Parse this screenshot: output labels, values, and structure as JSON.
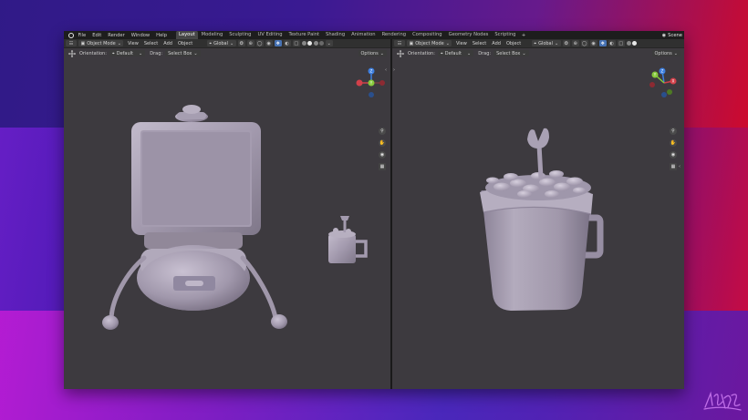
{
  "topbar": {
    "menus": [
      "File",
      "Edit",
      "Render",
      "Window",
      "Help"
    ],
    "workspaces": [
      "Layout",
      "Modeling",
      "Sculpting",
      "UV Editing",
      "Texture Paint",
      "Shading",
      "Animation",
      "Rendering",
      "Compositing",
      "Geometry Nodes",
      "Scripting"
    ],
    "active_workspace": "Layout",
    "add_tab": "+",
    "scene_label": "Scene"
  },
  "viewports": {
    "left": {
      "header": {
        "mode": "Object Mode",
        "menus": [
          "View",
          "Select",
          "Add",
          "Object"
        ],
        "transform": "Global"
      },
      "toolbar": {
        "orientation_label": "Orientation:",
        "orientation_value": "Default",
        "drag_label": "Drag:",
        "drag_value": "Select Box",
        "options_label": "Options"
      },
      "gizmo": {
        "x": "X",
        "y": "Y",
        "z": "Z"
      }
    },
    "right": {
      "header": {
        "mode": "Object Mode",
        "menus": [
          "View",
          "Select",
          "Add",
          "Object"
        ],
        "transform": "Global"
      },
      "toolbar": {
        "orientation_label": "Orientation:",
        "orientation_value": "Default",
        "drag_label": "Drag:",
        "drag_value": "Select Box",
        "options_label": "Options"
      },
      "gizmo": {
        "x": "X",
        "y": "Y",
        "z": "Z"
      }
    }
  },
  "icons": {
    "zoom": "magnifier-icon",
    "pan": "hand-icon",
    "camera": "camera-icon",
    "grid": "grid-icon"
  },
  "colors": {
    "viewport_bg": "#3d3a3f",
    "model_clay": "#a39aae",
    "axis_x": "#d2404a",
    "axis_y": "#86c93a",
    "axis_z": "#3d7fe0",
    "accent": "#4772b3"
  }
}
